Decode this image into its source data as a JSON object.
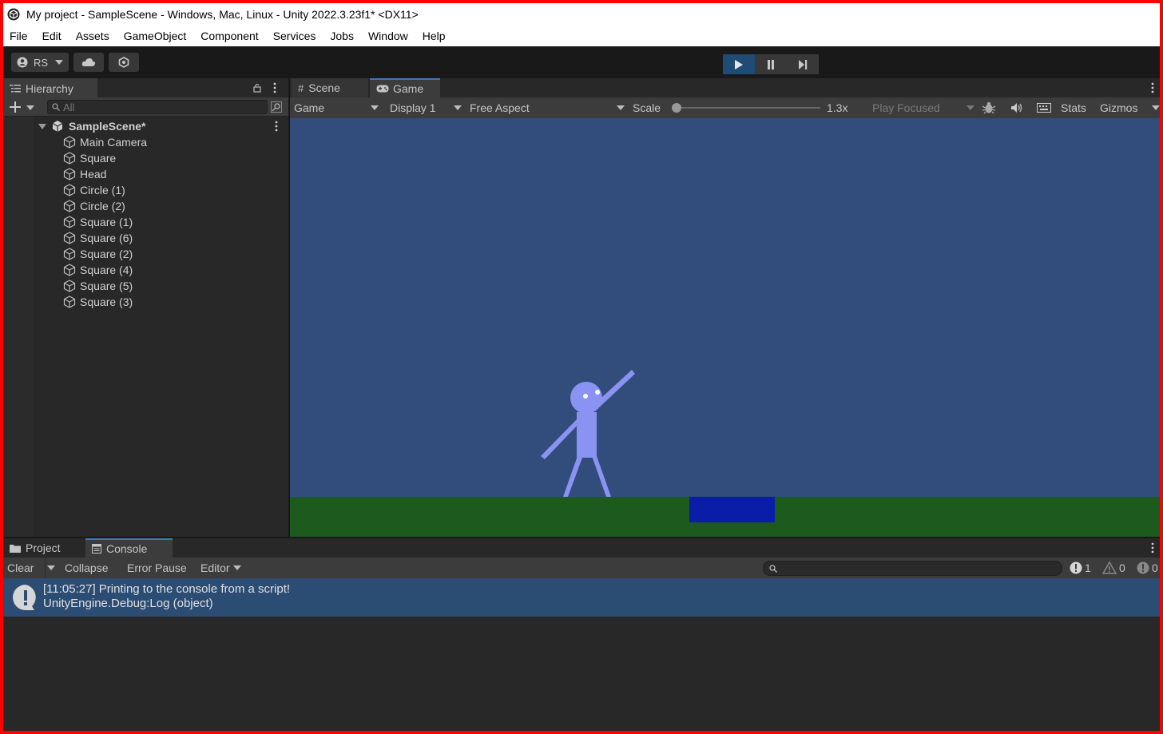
{
  "window": {
    "title": "My project - SampleScene - Windows, Mac, Linux - Unity 2022.3.23f1* <DX11>"
  },
  "menu": [
    "File",
    "Edit",
    "Assets",
    "GameObject",
    "Component",
    "Services",
    "Jobs",
    "Window",
    "Help"
  ],
  "toolbar": {
    "account_label": "RS"
  },
  "hierarchy": {
    "tab_label": "Hierarchy",
    "search_placeholder": "All",
    "scene_name": "SampleScene*",
    "items": [
      "Main Camera",
      "Square",
      "Head",
      "Circle (1)",
      "Circle (2)",
      "Square (1)",
      "Square (6)",
      "Square (2)",
      "Square (4)",
      "Square (5)",
      "Square (3)"
    ]
  },
  "view_tabs": {
    "scene": "Scene",
    "game": "Game"
  },
  "game_toolbar": {
    "view_mode": "Game",
    "display": "Display 1",
    "aspect": "Free Aspect",
    "scale_label": "Scale",
    "scale_value": "1.3x",
    "play_mode": "Play Focused",
    "stats": "Stats",
    "gizmos": "Gizmos"
  },
  "game_view": {
    "sky_color": "#324d7b",
    "ground_color": "#1c5b1d",
    "character_color": "#8a93f2",
    "box_color": "#0a1da8"
  },
  "bottom_tabs": {
    "project": "Project",
    "console": "Console"
  },
  "console_toolbar": {
    "clear": "Clear",
    "collapse": "Collapse",
    "error_pause": "Error Pause",
    "editor": "Editor",
    "log_count": "1",
    "warning_count": "0",
    "error_count": "0"
  },
  "console_entries": [
    {
      "line1": "[11:05:27] Printing to the console from a script!",
      "line2": "UnityEngine.Debug:Log (object)"
    }
  ]
}
